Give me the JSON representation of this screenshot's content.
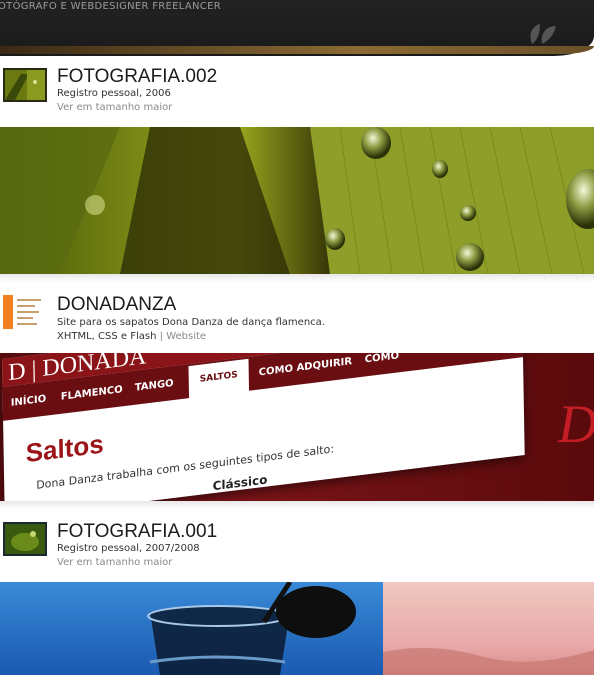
{
  "header": {
    "tagline": "OTÓGRAFO E WEBDESIGNER FREELANCER",
    "logo_icon": "leaf-icon"
  },
  "entries": [
    {
      "title": "FOTOGRAFIA.002",
      "description": "Registro pessoal, 2006",
      "link": "Ver em tamanho maior",
      "banner": "photo-leaf-droplets"
    },
    {
      "title": "DONADANZA",
      "description": "Site para os sapatos Dona Danza de dança flamenca.",
      "tech": "XHTML, CSS e Flash",
      "separator": "|",
      "link": "Website",
      "banner": "site-screenshot",
      "site": {
        "logo": "D | DONADA",
        "nav": [
          "INÍCIO",
          "FLAMENCO",
          "TANGO",
          "SALTOS",
          "COMO ADQUIRIR",
          "COMO"
        ],
        "heading": "Saltos",
        "paragraph": "Dona Danza trabalha com os seguintes tipos de salto:",
        "subheading": "Clássico",
        "right_letter": "D"
      }
    },
    {
      "title": "FOTOGRAFIA.001",
      "description": "Registro pessoal, 2007/2008",
      "link": "Ver em tamanho maior",
      "banner": "photo-glass-sky"
    }
  ],
  "colors": {
    "header_bg": "#1a1a1a",
    "stripe": "#8a6a34",
    "brand_red": "#9a1418"
  }
}
